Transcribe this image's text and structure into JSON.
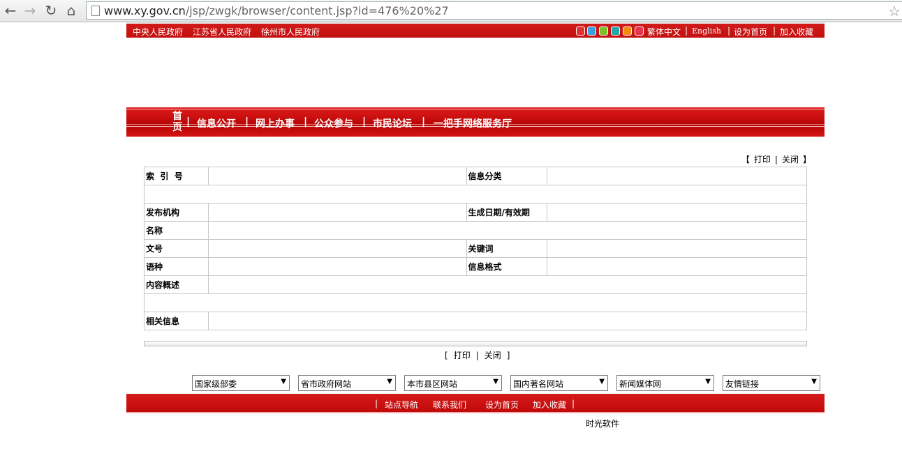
{
  "browser": {
    "back": "←",
    "forward": "→",
    "reload": "↻",
    "home": "⌂",
    "url_domain": "www.xy.gov.cn",
    "url_path": "/jsp/zwgk/browser/content.jsp?id=476%20%27",
    "star": "☆"
  },
  "topbar": {
    "links": [
      "中央人民政府",
      "江苏省人民政府",
      "徐州市人民政府"
    ],
    "swatch_colors": [
      "#e53030",
      "#3aa0e0",
      "#7bc22a",
      "#22a8a8",
      "#f08c10",
      "#e8344a"
    ],
    "right_links": [
      "繁体中文",
      "English",
      "设为首页",
      "加入收藏"
    ],
    "separator": "|"
  },
  "mainnav": {
    "home_label": "首页",
    "items": [
      "信息公开",
      "网上办事",
      "公众参与",
      "市民论坛",
      "一把手网络服务厅"
    ],
    "separator": "|"
  },
  "print_top": {
    "open": "【",
    "print": "打印",
    "sep": "|",
    "close": "关闭",
    "end": "】"
  },
  "info_table": {
    "index_no": "索  引  号",
    "category": "信息分类",
    "publisher": "发布机构",
    "date": "生成日期/有效期",
    "name": "名称",
    "doc_no": "文号",
    "keywords": "关键词",
    "language": "语种",
    "format": "信息格式",
    "summary": "内容概述",
    "related": "相关信息"
  },
  "print_bottom": {
    "open": "[",
    "print": "打印",
    "sep": "|",
    "close": "关闭",
    "end": "]"
  },
  "dropdowns": [
    "国家级部委",
    "省市政府网站",
    "本市县区网站",
    "国内著名网站",
    "新闻媒体网",
    "友情链接"
  ],
  "footer": {
    "sep": "|",
    "links": [
      "站点导航",
      "联系我们",
      "设为首页",
      "加入收藏"
    ]
  },
  "credit": "时光软件"
}
